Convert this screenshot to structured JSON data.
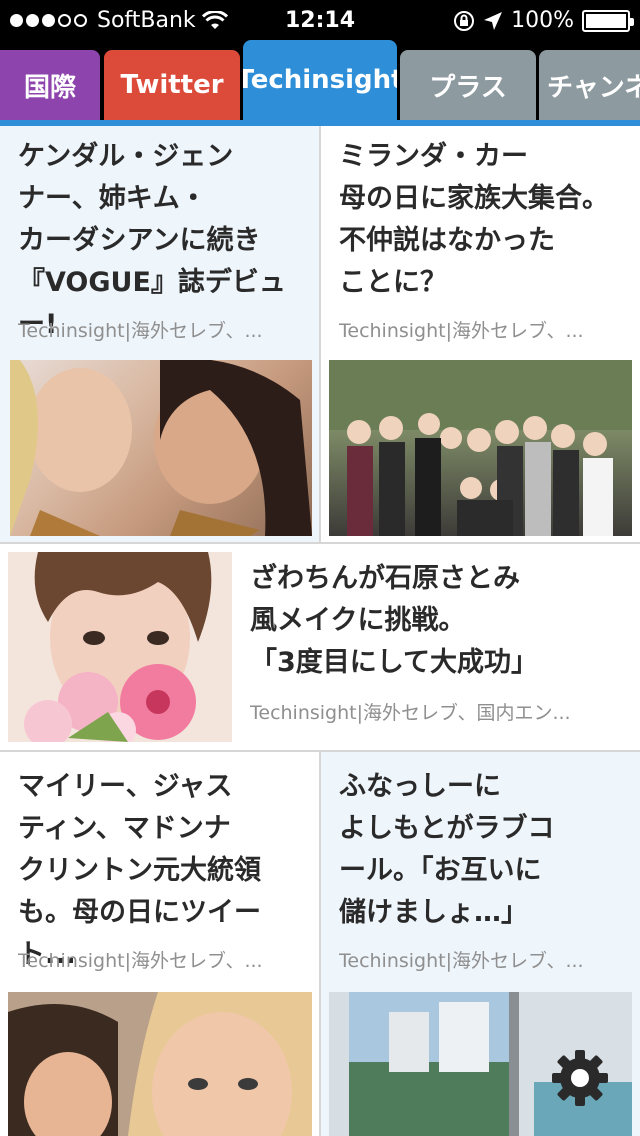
{
  "status_bar": {
    "carrier": "SoftBank",
    "time": "12:14",
    "battery": "100%",
    "signal_bars": 3,
    "battery_level": 1.0
  },
  "tabs": [
    {
      "label": "国際",
      "color": "#8e44ad"
    },
    {
      "label": "Twitter",
      "color": "#dc4a3a"
    },
    {
      "label": "Techinsight",
      "color": "#2e8fd8",
      "active": true
    },
    {
      "label": "プラス",
      "color": "#8d9aa0"
    },
    {
      "label": "チャンネ",
      "color": "#8d9aa0"
    }
  ],
  "articles": [
    {
      "title_lines": [
        "ケンダル・ジェン",
        "ナー、姉キム・",
        "カーダシアンに続き",
        "『VOGUE』誌デビュー!"
      ],
      "source": "Techinsight|海外セレブ、..."
    },
    {
      "title_lines": [
        "ミランダ・カー",
        "母の日に家族大集合。",
        "不仲説はなかった",
        "ことに？"
      ],
      "source": "Techinsight|海外セレブ、..."
    },
    {
      "title_lines": [
        "ざわちんが石原さとみ",
        "風メイクに挑戦。",
        "「3度目にして大成功」"
      ],
      "source": "Techinsight|海外セレブ、国内エン..."
    },
    {
      "title_lines": [
        "マイリー、ジャス",
        "ティン、マドンナ",
        "クリントン元大統領",
        "も。母の日にツイート..."
      ],
      "source": "Techinsight|海外セレブ、..."
    },
    {
      "title_lines": [
        "ふなっしーに",
        "よしもとがラブコ",
        "ール。「お互いに",
        "儲けましょ…」"
      ],
      "source": "Techinsight|海外セレブ、..."
    }
  ],
  "icons": {
    "settings": "gear-icon"
  }
}
